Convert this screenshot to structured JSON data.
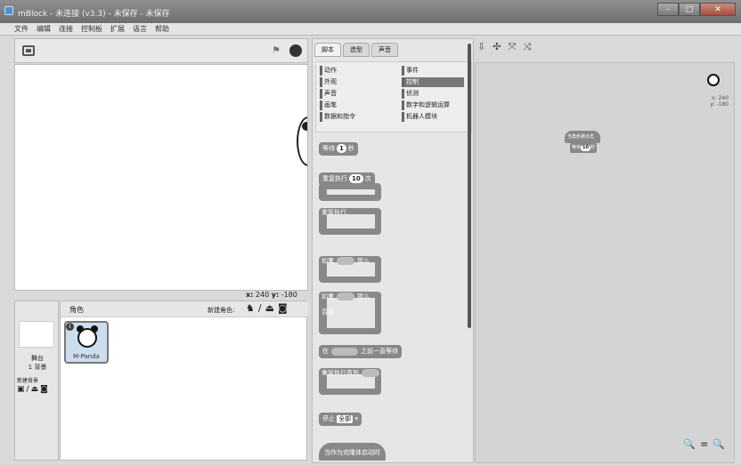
{
  "window": {
    "title": "mBlock - 未连接 (v3.3) - 未保存 - 未保存",
    "minimize": "–",
    "maximize": "□",
    "close": "✕"
  },
  "menu": [
    "文件",
    "编辑",
    "连接",
    "控制板",
    "扩展",
    "语言",
    "帮助"
  ],
  "stage": {
    "coords_x_label": "x:",
    "coords_x": "240",
    "coords_y_label": "y:",
    "coords_y": "-180"
  },
  "sprites_panel": {
    "header": "角色",
    "new_sprite_label": "新建角色:",
    "sprite_name": "M-Panda",
    "info_badge": "i"
  },
  "stage_panel": {
    "label": "舞台",
    "bg_count": "1 背景",
    "new_bg_label": "新建背景"
  },
  "tabs": [
    "脚本",
    "造型",
    "声音"
  ],
  "categories_left": [
    "动作",
    "外观",
    "声音",
    "画笔",
    "数据和指令"
  ],
  "categories_right": [
    "事件",
    "控制",
    "侦测",
    "数字和逻辑运算",
    "机器人模块"
  ],
  "selected_category": "控制",
  "palette": {
    "wait": {
      "text": "等待",
      "value": "1",
      "unit": "秒"
    },
    "repeat": {
      "text": "重复执行",
      "value": "10",
      "unit": "次"
    },
    "forever": {
      "text": "重复执行"
    },
    "if_then": {
      "prefix": "如果",
      "suffix": "那么"
    },
    "if_else": {
      "prefix": "如果",
      "suffix": "那么",
      "else_label": "否则"
    },
    "wait_until": {
      "prefix": "在",
      "suffix": "之前一直等待"
    },
    "repeat_until": {
      "text": "重复执行直到"
    },
    "stop": {
      "text": "停止",
      "option": "全部"
    },
    "when_clone": {
      "text": "当作为克隆体启动时"
    }
  },
  "script": {
    "hat": "当角色被点击",
    "cmd": "等待",
    "value": "10",
    "unit": "秒"
  },
  "mini_sprite": {
    "x": "x: 240",
    "y": "y: -180"
  },
  "zoom": {
    "out": "🔍",
    "reset": "=",
    "in": "🔍"
  }
}
